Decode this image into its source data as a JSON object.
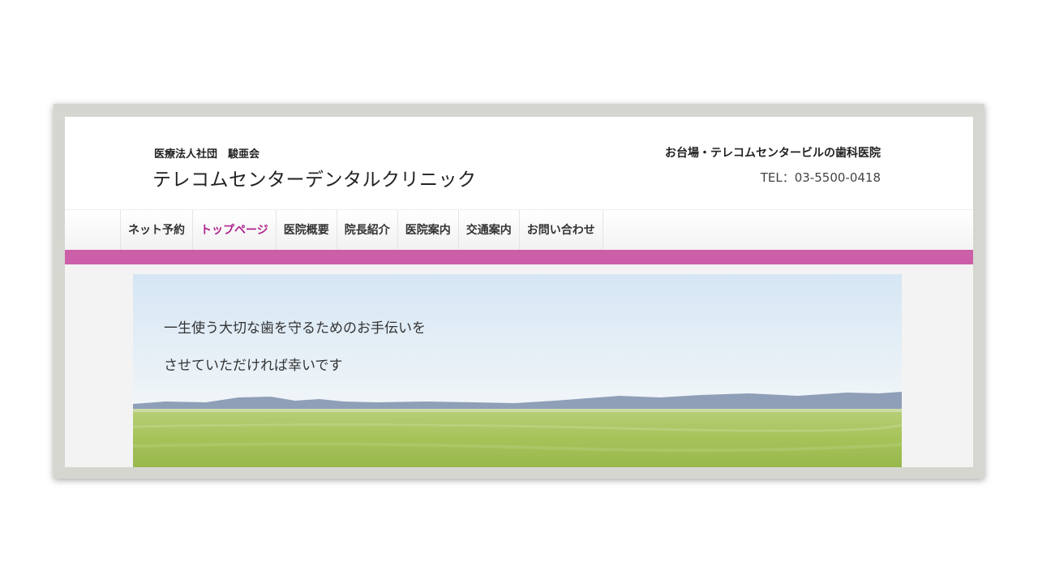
{
  "header": {
    "org_name": "医療法人社団　駿亜会",
    "clinic_name": "テレコムセンターデンタルクリニック",
    "tagline": "お台場・テレコムセンタービルの歯科医院",
    "tel": "TEL：03-5500-0418"
  },
  "nav": {
    "items": [
      {
        "label": "ネット予約"
      },
      {
        "label": "トップページ"
      },
      {
        "label": "医院概要"
      },
      {
        "label": "院長紹介"
      },
      {
        "label": "医院案内"
      },
      {
        "label": "交通案内"
      },
      {
        "label": "お問い合わせ"
      }
    ],
    "active_index": 1
  },
  "hero": {
    "line1": "一生使う大切な歯を守るためのお手伝いを",
    "line2": "させていただければ幸いです"
  },
  "colors": {
    "accent": "#cb5fa8",
    "active_nav": "#b0238e",
    "sky": "#dce9f4",
    "grass": "#a9c561",
    "mountains": "#8d9db8"
  }
}
